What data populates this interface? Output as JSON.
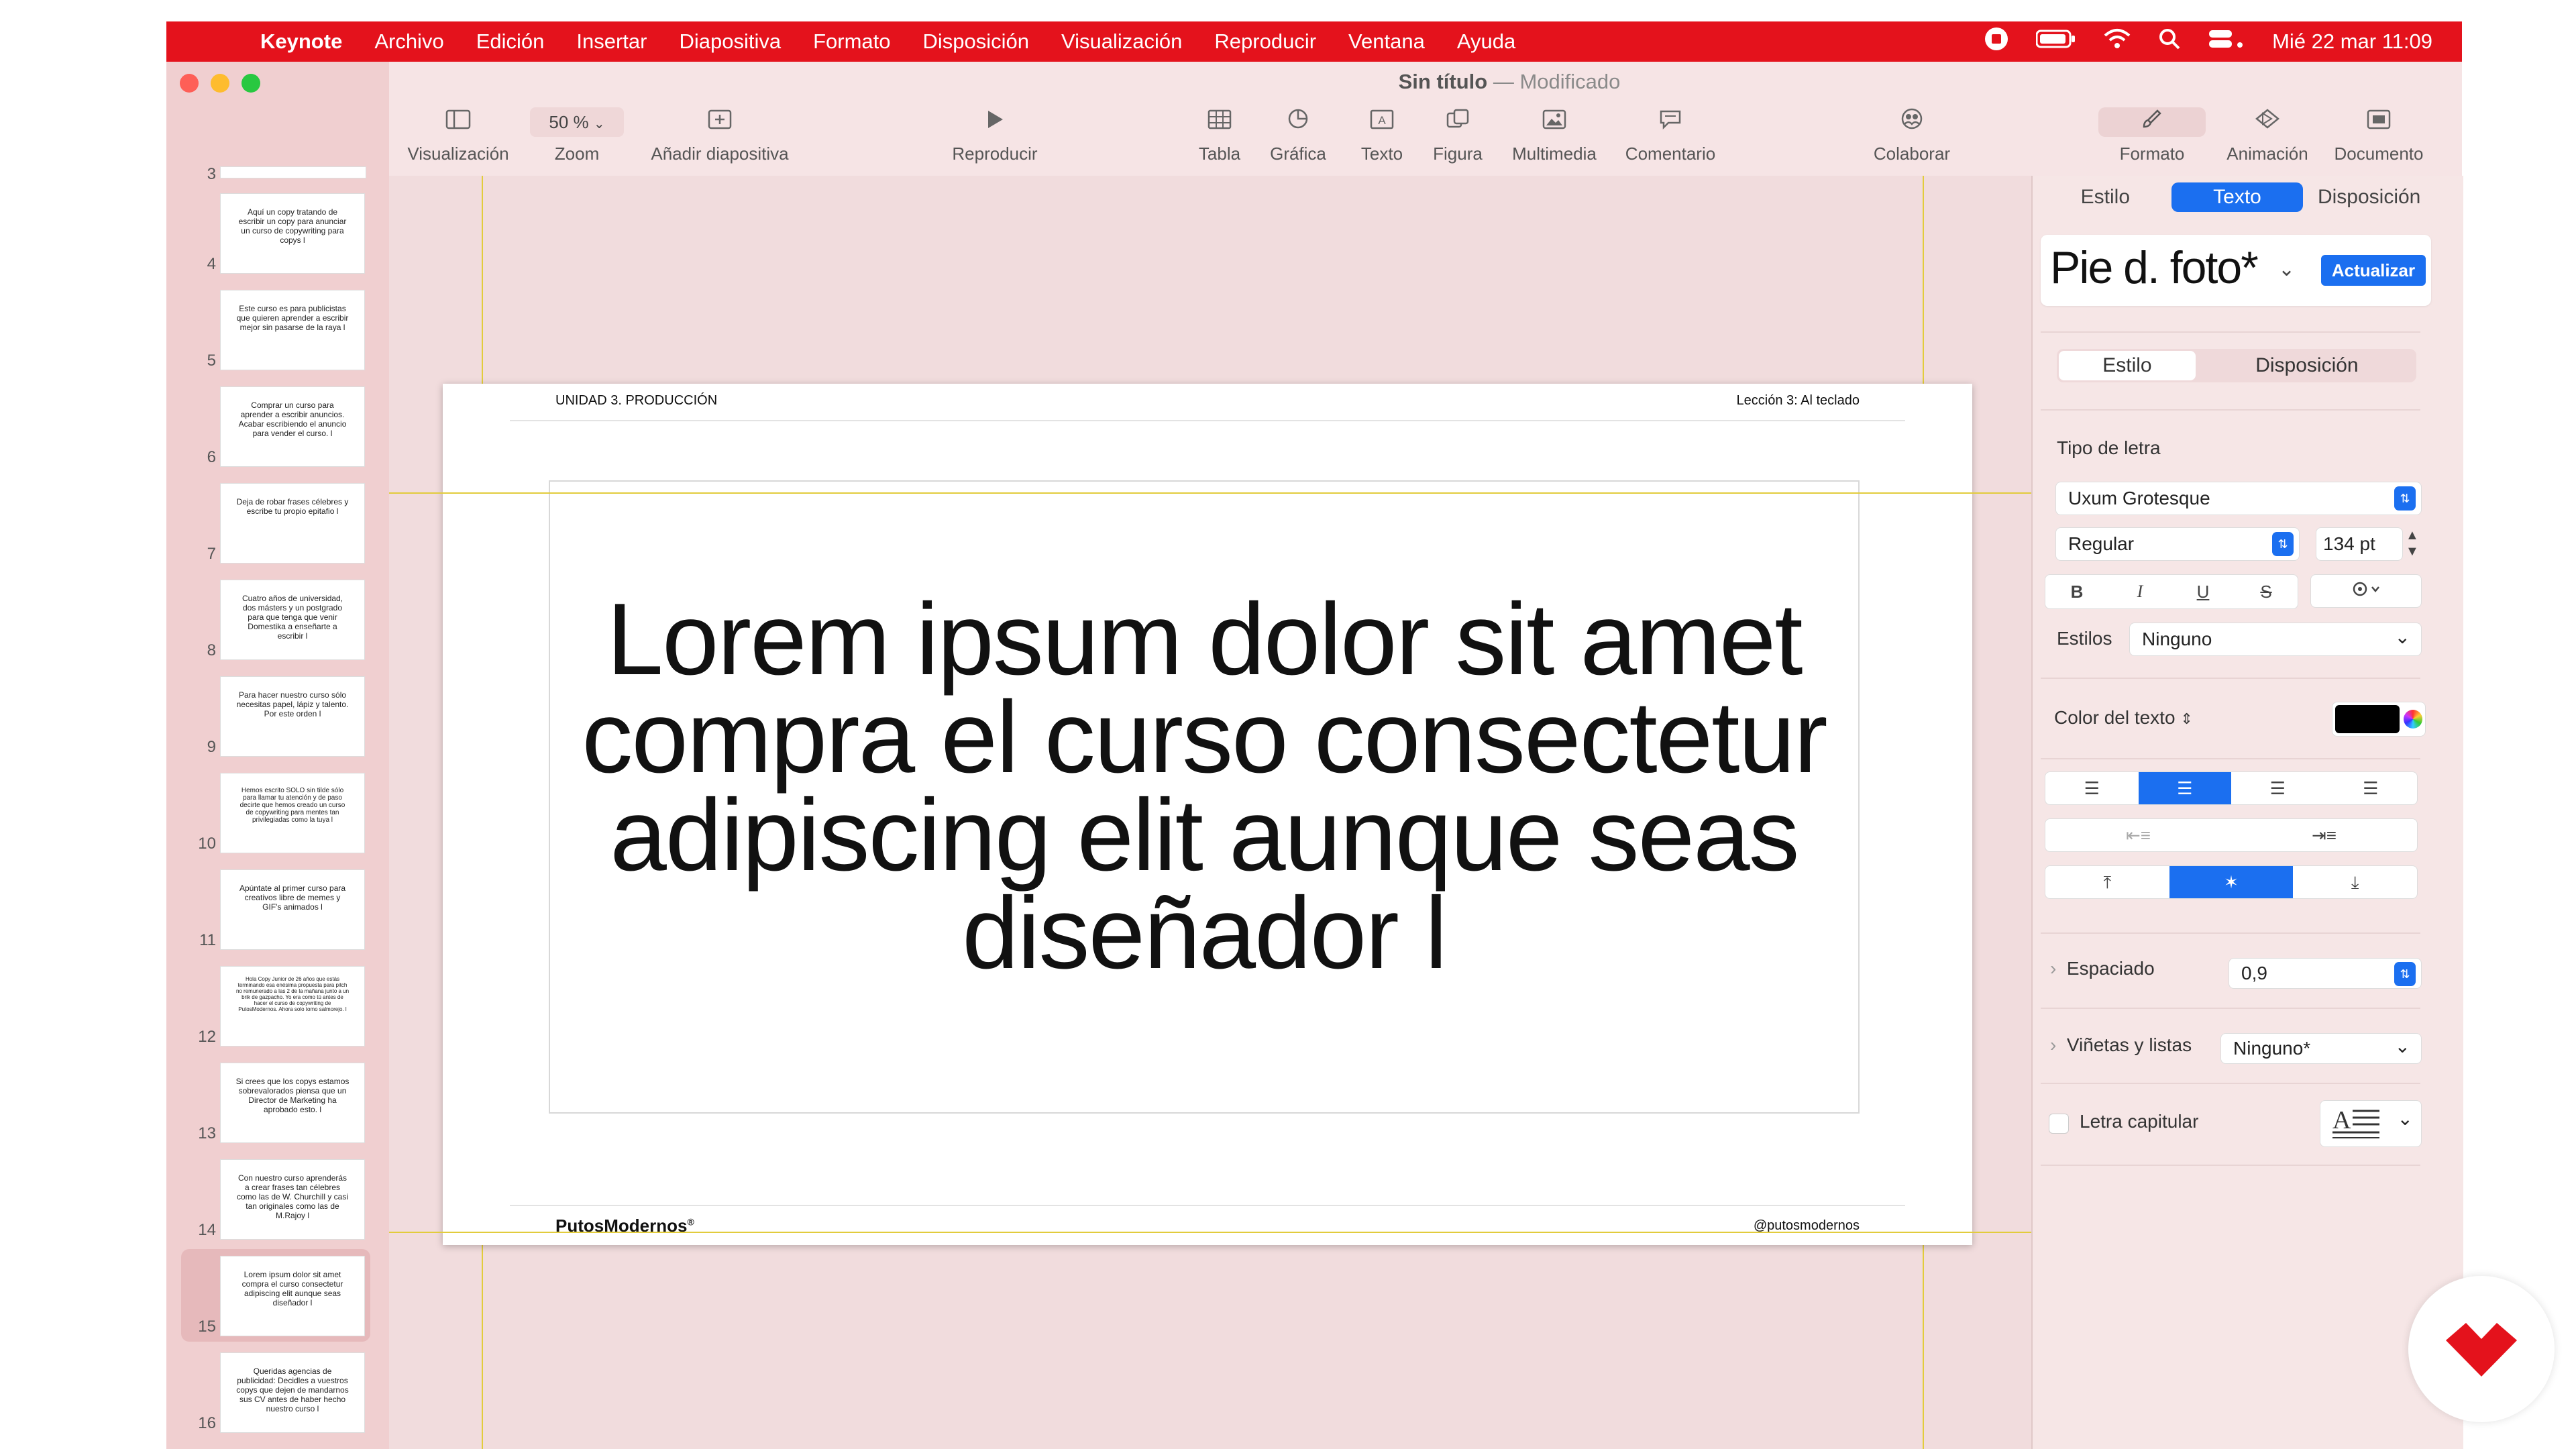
{
  "menubar": {
    "apple": "",
    "items": [
      "Keynote",
      "Archivo",
      "Edición",
      "Insertar",
      "Diapositiva",
      "Formato",
      "Disposición",
      "Visualización",
      "Reproducir",
      "Ventana",
      "Ayuda"
    ],
    "datetime": "Mié 22 mar  11:09"
  },
  "window": {
    "title": "Sin título",
    "separator": "—",
    "status": "Modificado"
  },
  "toolbar": {
    "view": "Visualización",
    "zoom_value": "50 %",
    "zoom": "Zoom",
    "add_slide": "Añadir diapositiva",
    "play": "Reproducir",
    "table": "Tabla",
    "chart": "Gráfica",
    "text": "Texto",
    "shape": "Figura",
    "media": "Multimedia",
    "comment": "Comentario",
    "collaborate": "Colaborar",
    "format": "Formato",
    "animation": "Animación",
    "document": "Documento"
  },
  "slides": [
    {
      "num": "4",
      "text": "Aquí un copy tratando de escribir un copy para anunciar un curso de copywriting para copys l"
    },
    {
      "num": "5",
      "text": "Este curso es para publicistas que quieren aprender a escribir mejor sin pasarse de la raya l"
    },
    {
      "num": "6",
      "text": "Comprar un curso para aprender a escribir anuncios. Acabar escribiendo el anuncio para vender el curso. l"
    },
    {
      "num": "7",
      "text": "Deja de robar frases célebres y escribe tu propio epitafio l"
    },
    {
      "num": "8",
      "text": "Cuatro años de universidad, dos másters y un postgrado para que tenga que venir Domestika a enseñarte a escribir l"
    },
    {
      "num": "9",
      "text": "Para hacer nuestro curso sólo necesitas papel, lápiz y talento. Por este orden l"
    },
    {
      "num": "10",
      "text": "Hemos escrito SOLO sin tilde sólo para llamar tu atención y de paso decirte que hemos creado un curso de copywriting para mentes tan privilegiadas como la tuya l"
    },
    {
      "num": "11",
      "text": "Apúntate al primer curso para creativos libre de memes y GIF's animados l"
    },
    {
      "num": "12",
      "text": "Hola Copy Junior de 26 años que estás terminando esa enésima propuesta para pitch no remunerado a las 2 de la mañana junto a un brik de gazpacho. Yo era como tú antes de hacer el curso de copywriting de PutosModernos. Ahora solo tomo salmorejo. l"
    },
    {
      "num": "13",
      "text": "Si crees que los copys estamos sobrevalorados piensa que un Director de Marketing ha aprobado esto. l"
    },
    {
      "num": "14",
      "text": "Con nuestro curso aprenderás a crear frases tan célebres como las de W. Churchill y casi tan originales como las de M.Rajoy l"
    },
    {
      "num": "15",
      "text": "Lorem ipsum dolor sit amet compra el curso consectetur adipiscing elit aunque seas diseñador l"
    },
    {
      "num": "16",
      "text": "Queridas agencias de publicidad: Decidles a vuestros copys que dejen de mandarnos sus CV antes de haber hecho nuestro curso l"
    }
  ],
  "slide": {
    "header_left": "UNIDAD 3. PRODUCCIÓN",
    "header_right": "Lección 3: Al teclado",
    "headline": "Lorem ipsum dolor sit amet compra el curso consectetur adipiscing elit aunque seas diseñador l",
    "footer_left": "PutosModernos",
    "footer_mark": "®",
    "footer_right": "@putosmodernos"
  },
  "inspector": {
    "tabs": [
      "Estilo",
      "Texto",
      "Disposición"
    ],
    "active_tab": "Texto",
    "paragraph_style": "Pie d. foto*",
    "update_button": "Actualizar",
    "subtabs": [
      "Estilo",
      "Disposición"
    ],
    "font_section": "Tipo de letra",
    "font_family": "Uxum Grotesque",
    "font_weight": "Regular",
    "font_size": "134 pt",
    "bold": "B",
    "italic": "I",
    "underline": "U",
    "strike": "S",
    "styles_label": "Estilos",
    "styles_value": "Ninguno",
    "text_color_label": "Color del texto",
    "text_color_value": "#000000",
    "spacing_label": "Espaciado",
    "spacing_value": "0,9",
    "bullets_label": "Viñetas y listas",
    "bullets_value": "Ninguno*",
    "dropcap_label": "Letra capitular",
    "accent_color": "#1b6ff0"
  }
}
